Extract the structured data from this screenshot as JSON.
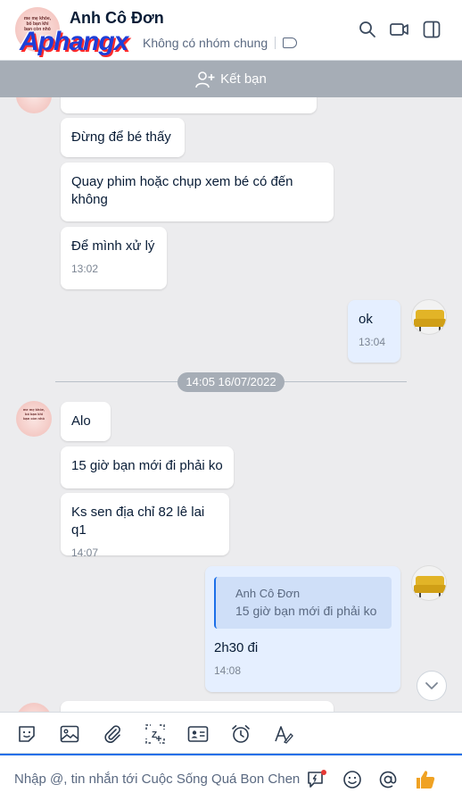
{
  "header": {
    "title": "Anh Cô Đơn",
    "subtitle": "Không có nhóm chung",
    "watermark": "Aphangx",
    "avatar_text": "me mẹ khỏe, bố bạn khi bạn còn nhỏ"
  },
  "friend_bar": {
    "label": "Kết bạn"
  },
  "messages": {
    "m1": {
      "text": "Đừng để bé thấy"
    },
    "m2": {
      "text": "Quay phim hoặc chụp xem bé có đến không"
    },
    "m3": {
      "text": "Để mình xử lý",
      "time": "13:02"
    },
    "m4": {
      "text": "ok",
      "time": "13:04"
    },
    "date_separator": "14:05 16/07/2022",
    "m5": {
      "text": "Alo"
    },
    "m6": {
      "text": "15 giờ bạn mới đi phải ko"
    },
    "m7": {
      "text": "Ks sen địa chỉ 82 lê lai q1",
      "time": "14:07"
    },
    "m8": {
      "quote_name": "Anh Cô Đơn",
      "quote_text": "15 giờ bạn mới đi phải ko",
      "text": "2h30 đi",
      "time": "14:08"
    }
  },
  "input": {
    "placeholder": "Nhập @, tin nhắn tới Cuộc Sống Quá Bon Chen"
  },
  "icons": {
    "header": [
      "search-icon",
      "video-call-icon",
      "sidebar-toggle-icon"
    ],
    "toolbar": [
      "sticker-icon",
      "image-icon",
      "attachment-icon",
      "screenshot-icon",
      "contact-card-icon",
      "reminder-icon",
      "text-format-icon"
    ],
    "input": [
      "quick-message-icon",
      "emoji-icon",
      "mention-icon",
      "thumbs-up-icon"
    ]
  },
  "colors": {
    "accent": "#1c6fe8",
    "mine_bubble": "#e5efff",
    "thumbs_up": "#f0a223",
    "friend_bar": "#a6adb6"
  }
}
